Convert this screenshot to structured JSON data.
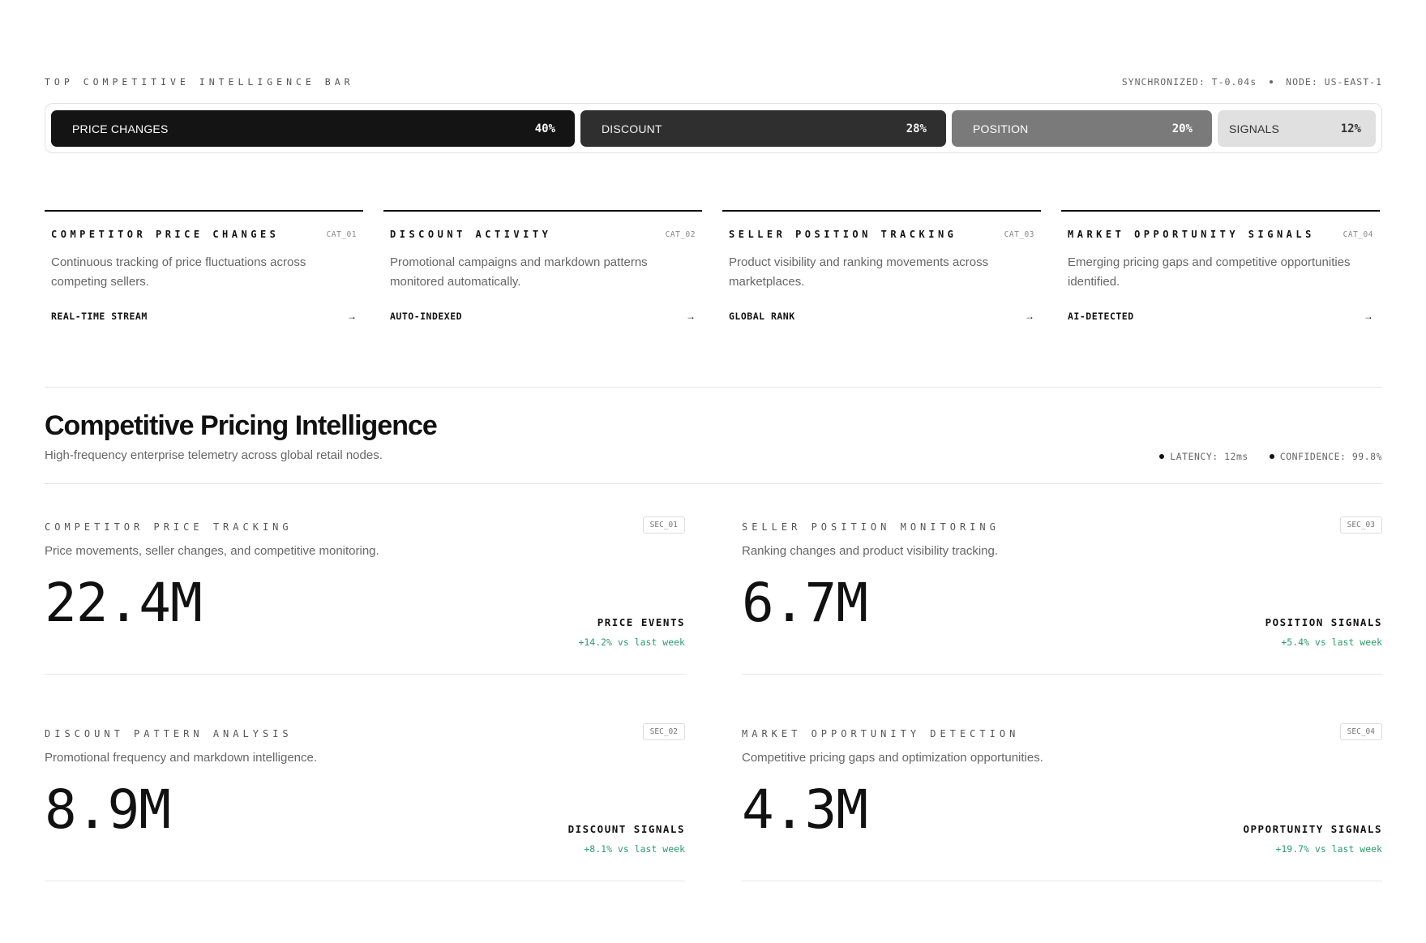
{
  "topbar": {
    "title": "TOP COMPETITIVE INTELLIGENCE BAR",
    "sync": "SYNCHRONIZED: T-0.04s",
    "node": "NODE: US-EAST-1"
  },
  "segments": [
    {
      "label": "PRICE CHANGES",
      "value": "40%",
      "share": 40,
      "color": "#141414"
    },
    {
      "label": "DISCOUNT",
      "value": "28%",
      "share": 28,
      "color": "#2f2f2f"
    },
    {
      "label": "POSITION",
      "value": "20%",
      "share": 20,
      "color": "#7a7a7a"
    },
    {
      "label": "SIGNALS",
      "value": "12%",
      "share": 12,
      "color": "#e0e0e0"
    }
  ],
  "categories": [
    {
      "title": "COMPETITOR PRICE CHANGES",
      "code": "CAT_01",
      "desc": "Continuous tracking of price fluctuations across competing sellers.",
      "tag": "REAL-TIME STREAM"
    },
    {
      "title": "DISCOUNT ACTIVITY",
      "code": "CAT_02",
      "desc": "Promotional campaigns and markdown patterns monitored automatically.",
      "tag": "AUTO-INDEXED"
    },
    {
      "title": "SELLER POSITION TRACKING",
      "code": "CAT_03",
      "desc": "Product visibility and ranking movements across marketplaces.",
      "tag": "GLOBAL RANK"
    },
    {
      "title": "MARKET OPPORTUNITY SIGNALS",
      "code": "CAT_04",
      "desc": "Emerging pricing gaps and competitive opportunities identified.",
      "tag": "AI-DETECTED"
    }
  ],
  "arrow_glyph": "→",
  "section": {
    "title": "Competitive Pricing Intelligence",
    "subtitle": "High-frequency enterprise telemetry across global retail nodes.",
    "latency": "LATENCY: 12ms",
    "confidence": "CONFIDENCE: 99.8%"
  },
  "panels": [
    {
      "title": "COMPETITOR PRICE TRACKING",
      "code": "SEC_01",
      "desc": "Price movements, seller changes, and competitive monitoring.",
      "value": "22.4M",
      "label": "PRICE EVENTS",
      "delta": "+14.2% vs last week"
    },
    {
      "title": "SELLER POSITION MONITORING",
      "code": "SEC_03",
      "desc": "Ranking changes and product visibility tracking.",
      "value": "6.7M",
      "label": "POSITION SIGNALS",
      "delta": "+5.4% vs last week"
    },
    {
      "title": "DISCOUNT PATTERN ANALYSIS",
      "code": "SEC_02",
      "desc": "Promotional frequency and markdown intelligence.",
      "value": "8.9M",
      "label": "DISCOUNT SIGNALS",
      "delta": "+8.1% vs last week"
    },
    {
      "title": "MARKET OPPORTUNITY DETECTION",
      "code": "SEC_04",
      "desc": "Competitive pricing gaps and optimization opportunities.",
      "value": "4.3M",
      "label": "OPPORTUNITY SIGNALS",
      "delta": "+19.7% vs last week"
    }
  ],
  "colors": {
    "positive": "#2e9d6a",
    "ink": "#111111"
  }
}
